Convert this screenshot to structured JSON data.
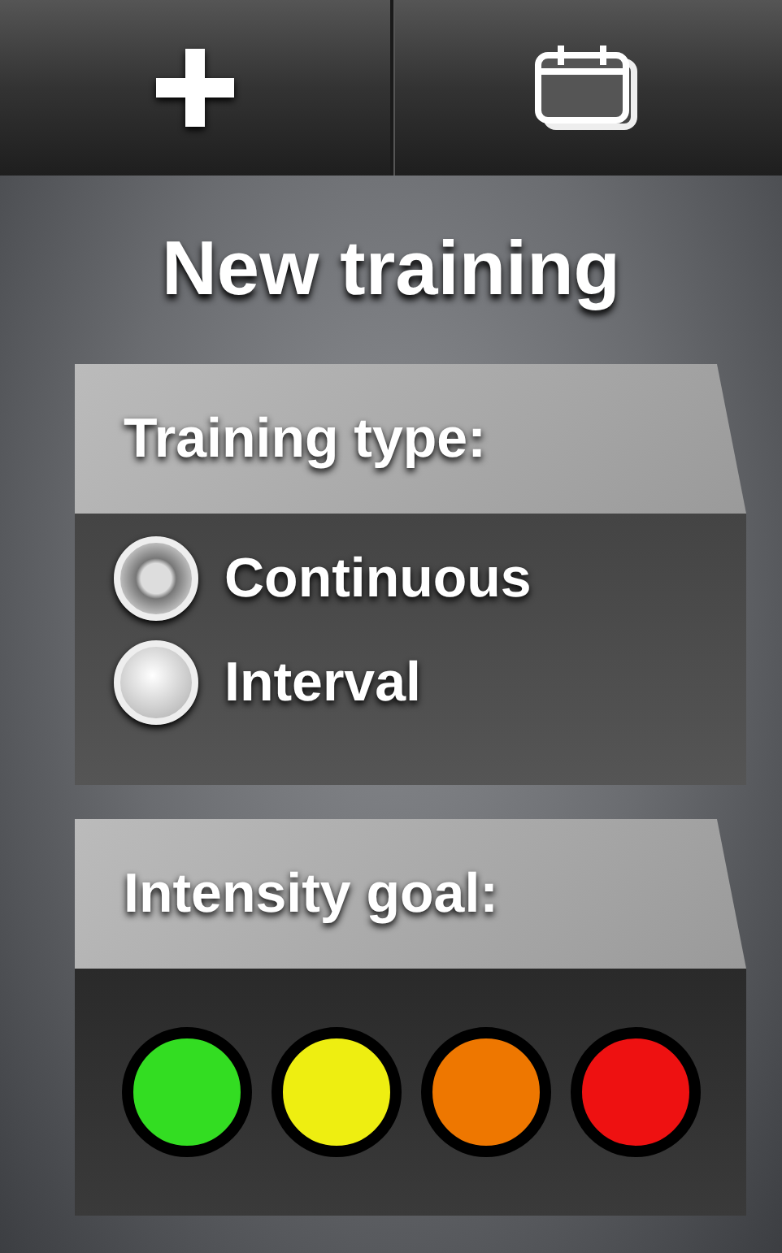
{
  "toolbar": {
    "buttons": [
      {
        "kind": "add"
      },
      {
        "kind": "calendar"
      }
    ]
  },
  "title": "New training",
  "training_type": {
    "label": "Training type:",
    "options": [
      {
        "label": "Continuous",
        "selected": true
      },
      {
        "label": "Interval",
        "selected": false
      }
    ]
  },
  "intensity_goal": {
    "label": "Intensity goal:",
    "levels": [
      {
        "color": "#33dd22"
      },
      {
        "color": "#eeee11"
      },
      {
        "color": "#ee7700"
      },
      {
        "color": "#ee1111"
      }
    ]
  }
}
